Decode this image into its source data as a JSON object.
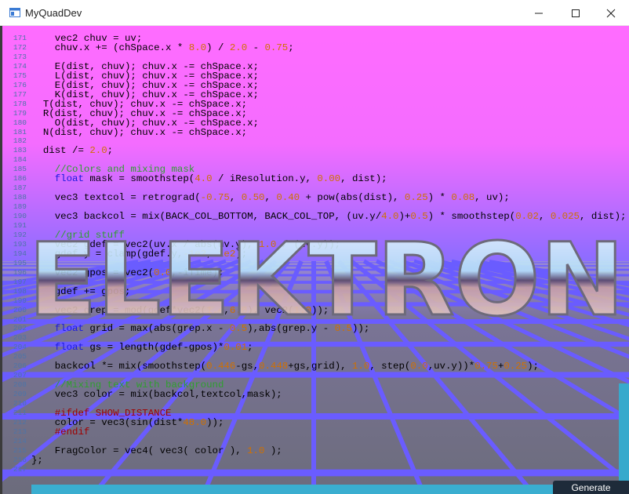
{
  "window": {
    "title": "MyQuadDev",
    "controls": [
      "minimize-icon",
      "maximize-icon",
      "close-icon"
    ]
  },
  "watermark": {
    "text": "ELEKTRON"
  },
  "code_lines": [
    {
      "num": "171",
      "segs": [
        {
          "t": "    vec2 chuv = uv;"
        }
      ]
    },
    {
      "num": "172",
      "segs": [
        {
          "t": "    chuv.x += (chSpace.x * "
        },
        {
          "t": "8.0",
          "c": "n"
        },
        {
          "t": ") / "
        },
        {
          "t": "2.0",
          "c": "n"
        },
        {
          "t": " - "
        },
        {
          "t": "0.75",
          "c": "n"
        },
        {
          "t": ";"
        }
      ]
    },
    {
      "num": "173",
      "segs": [
        {
          "t": ""
        }
      ]
    },
    {
      "num": "174",
      "segs": [
        {
          "t": "    E(dist, chuv); chuv.x -= chSpace.x;"
        }
      ]
    },
    {
      "num": "175",
      "segs": [
        {
          "t": "    L(dist, chuv); chuv.x -= chSpace.x;"
        }
      ]
    },
    {
      "num": "176",
      "segs": [
        {
          "t": "    E(dist, chuv); chuv.x -= chSpace.x;"
        }
      ]
    },
    {
      "num": "177",
      "segs": [
        {
          "t": "    K(dist, chuv); chuv.x -= chSpace.x;"
        }
      ]
    },
    {
      "num": "178",
      "segs": [
        {
          "t": "  T(dist, chuv); chuv.x -= chSpace.x;"
        }
      ]
    },
    {
      "num": "179",
      "segs": [
        {
          "t": "  R(dist, chuv); chuv.x -= chSpace.x;"
        }
      ]
    },
    {
      "num": "180",
      "segs": [
        {
          "t": "    O(dist, chuv); chuv.x -= chSpace.x;"
        }
      ]
    },
    {
      "num": "181",
      "segs": [
        {
          "t": "  N(dist, chuv); chuv.x -= chSpace.x;"
        }
      ]
    },
    {
      "num": "182",
      "segs": [
        {
          "t": ""
        }
      ]
    },
    {
      "num": "183",
      "segs": [
        {
          "t": "  dist /= "
        },
        {
          "t": "2.0",
          "c": "n"
        },
        {
          "t": ";"
        }
      ]
    },
    {
      "num": "184",
      "segs": [
        {
          "t": ""
        }
      ]
    },
    {
      "num": "185",
      "segs": [
        {
          "t": "    "
        },
        {
          "t": "//Colors and mixing mask",
          "c": "c"
        }
      ]
    },
    {
      "num": "186",
      "segs": [
        {
          "t": "    "
        },
        {
          "t": "float",
          "c": "k"
        },
        {
          "t": " mask = smoothstep("
        },
        {
          "t": "4.0",
          "c": "n"
        },
        {
          "t": " / iResolution.y, "
        },
        {
          "t": "0.00",
          "c": "n"
        },
        {
          "t": ", dist);"
        }
      ]
    },
    {
      "num": "187",
      "segs": [
        {
          "t": ""
        }
      ]
    },
    {
      "num": "188",
      "segs": [
        {
          "t": "    vec3 textcol = retrograd("
        },
        {
          "t": "-0.75",
          "c": "n"
        },
        {
          "t": ", "
        },
        {
          "t": "0.50",
          "c": "n"
        },
        {
          "t": ", "
        },
        {
          "t": "0.40",
          "c": "n"
        },
        {
          "t": " + pow(abs(dist), "
        },
        {
          "t": "0.25",
          "c": "n"
        },
        {
          "t": ") * "
        },
        {
          "t": "0.08",
          "c": "n"
        },
        {
          "t": ", uv);"
        }
      ]
    },
    {
      "num": "189",
      "segs": [
        {
          "t": ""
        }
      ]
    },
    {
      "num": "190",
      "segs": [
        {
          "t": "    vec3 backcol = mix(BACK_COL_BOTTOM, BACK_COL_TOP, (uv.y/"
        },
        {
          "t": "4.0",
          "c": "n"
        },
        {
          "t": ")+"
        },
        {
          "t": "0.5",
          "c": "n"
        },
        {
          "t": ") * smoothstep("
        },
        {
          "t": "0.02",
          "c": "n"
        },
        {
          "t": ", "
        },
        {
          "t": "0.025",
          "c": "n"
        },
        {
          "t": ", dist);"
        }
      ]
    },
    {
      "num": "191",
      "segs": [
        {
          "t": ""
        }
      ]
    },
    {
      "num": "192",
      "segs": [
        {
          "t": "    "
        },
        {
          "t": "//grid stuff",
          "c": "c"
        }
      ]
    },
    {
      "num": "193",
      "segs": [
        {
          "t": "    vec2 gdef = vec2(uv.x / abs(uv.y), "
        },
        {
          "t": "1.0",
          "c": "n"
        },
        {
          "t": " / (uv.y));"
        }
      ]
    },
    {
      "num": "194",
      "segs": [
        {
          "t": "    gdef.y = clamp(gdef.y,"
        },
        {
          "t": "-1e2",
          "c": "n"
        },
        {
          "t": ", "
        },
        {
          "t": "1e2",
          "c": "n"
        },
        {
          "t": ");"
        }
      ]
    },
    {
      "num": "195",
      "segs": [
        {
          "t": ""
        }
      ]
    },
    {
      "num": "196",
      "segs": [
        {
          "t": "    vec2 gpos = vec2("
        },
        {
          "t": "0.0",
          "c": "n"
        },
        {
          "t": ",-iTime);"
        }
      ]
    },
    {
      "num": "197",
      "segs": [
        {
          "t": ""
        }
      ]
    },
    {
      "num": "198",
      "segs": [
        {
          "t": "    gdef += gpos;"
        }
      ]
    },
    {
      "num": "199",
      "segs": [
        {
          "t": ""
        }
      ]
    },
    {
      "num": "200",
      "segs": [
        {
          "t": "    vec2 grep = mod(gdef*vec2("
        },
        {
          "t": "1.4",
          "c": "n"
        },
        {
          "t": ","
        },
        {
          "t": "6.0",
          "c": "n"
        },
        {
          "t": "), vec2("
        },
        {
          "t": "1.0",
          "c": "n"
        },
        {
          "t": "));"
        }
      ]
    },
    {
      "num": "201",
      "segs": [
        {
          "t": ""
        }
      ]
    },
    {
      "num": "202",
      "segs": [
        {
          "t": "    "
        },
        {
          "t": "float",
          "c": "k"
        },
        {
          "t": " grid = max(abs(grep.x - "
        },
        {
          "t": "0.5",
          "c": "n"
        },
        {
          "t": "),abs(grep.y - "
        },
        {
          "t": "0.5",
          "c": "n"
        },
        {
          "t": "));"
        }
      ]
    },
    {
      "num": "203",
      "segs": [
        {
          "t": ""
        }
      ]
    },
    {
      "num": "204",
      "segs": [
        {
          "t": "    "
        },
        {
          "t": "float",
          "c": "k"
        },
        {
          "t": " gs = length(gdef-gpos)*"
        },
        {
          "t": "0.01",
          "c": "n"
        },
        {
          "t": ";"
        }
      ]
    },
    {
      "num": "205",
      "segs": [
        {
          "t": ""
        }
      ]
    },
    {
      "num": "206",
      "segs": [
        {
          "t": "    backcol *= mix(smoothstep("
        },
        {
          "t": "0.446",
          "c": "n"
        },
        {
          "t": "-gs,"
        },
        {
          "t": "0.448",
          "c": "n"
        },
        {
          "t": "+gs,grid), "
        },
        {
          "t": "1.0",
          "c": "n"
        },
        {
          "t": ", step("
        },
        {
          "t": "0.0",
          "c": "n"
        },
        {
          "t": ",uv.y))*"
        },
        {
          "t": "0.75",
          "c": "n"
        },
        {
          "t": "+"
        },
        {
          "t": "0.25",
          "c": "n"
        },
        {
          "t": ");"
        }
      ]
    },
    {
      "num": "207",
      "segs": [
        {
          "t": ""
        }
      ]
    },
    {
      "num": "208",
      "segs": [
        {
          "t": "    "
        },
        {
          "t": "//Mixing text with background",
          "c": "c"
        }
      ]
    },
    {
      "num": "209",
      "segs": [
        {
          "t": "    vec3 color = mix(backcol,textcol,mask);"
        }
      ]
    },
    {
      "num": "210",
      "segs": [
        {
          "t": ""
        }
      ]
    },
    {
      "num": "211",
      "segs": [
        {
          "t": "    "
        },
        {
          "t": "#ifdef SHOW_DISTANCE",
          "c": "p"
        }
      ]
    },
    {
      "num": "212",
      "segs": [
        {
          "t": "    color = vec3(sin(dist*"
        },
        {
          "t": "48.0",
          "c": "n"
        },
        {
          "t": "));"
        }
      ]
    },
    {
      "num": "213",
      "segs": [
        {
          "t": "    "
        },
        {
          "t": "#endif",
          "c": "p"
        }
      ]
    },
    {
      "num": "214",
      "segs": [
        {
          "t": ""
        }
      ]
    },
    {
      "num": "215",
      "segs": [
        {
          "t": "    FragColor = vec4( vec3( color ), "
        },
        {
          "t": "1.0",
          "c": "n"
        },
        {
          "t": " );"
        }
      ]
    },
    {
      "num": "216",
      "segs": [
        {
          "t": "};"
        }
      ]
    },
    {
      "num": "217",
      "segs": [
        {
          "t": ""
        }
      ]
    }
  ],
  "generate_button": {
    "label": "Generate"
  },
  "colors": {
    "sky_top": "#ff6cff",
    "sky_horizon": "#8c6cff",
    "ground": "#6e6e80",
    "grid": "#6a5cff",
    "accent": "#37a9cc",
    "button_bg": "#1e2b3a"
  }
}
